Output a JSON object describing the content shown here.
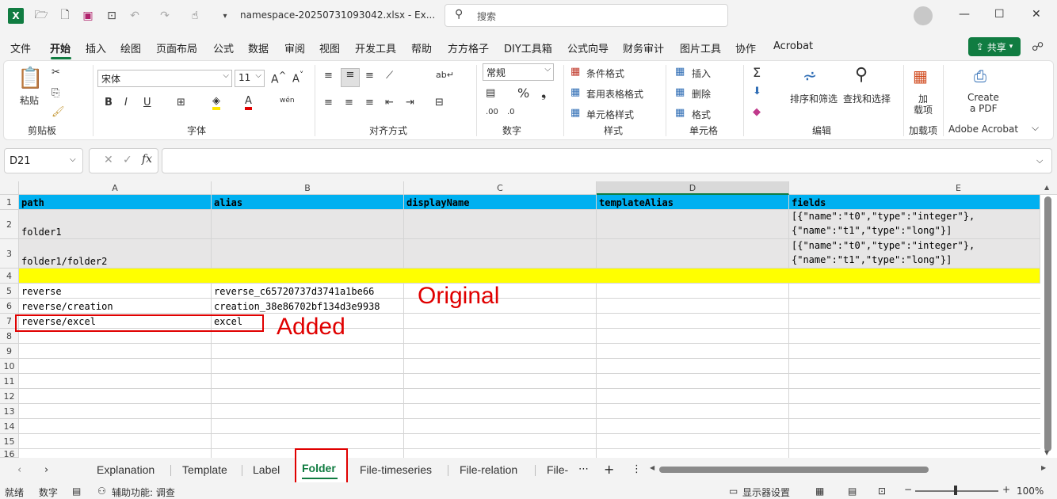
{
  "title_bar": {
    "filename": "namespace-20250731093042.xlsx  -  Ex...",
    "search_placeholder": "搜索"
  },
  "menu": [
    "文件",
    "开始",
    "插入",
    "绘图",
    "页面布局",
    "公式",
    "数据",
    "审阅",
    "视图",
    "开发工具",
    "帮助",
    "方方格子",
    "DIY工具箱",
    "公式向导",
    "财务审计",
    "图片工具",
    "协作",
    "Acrobat"
  ],
  "share_label": "共享",
  "ribbon": {
    "paste": "粘贴",
    "clipboard": "剪贴板",
    "font_name": "宋体",
    "font_size": "11",
    "font_group": "字体",
    "align_group": "对齐方式",
    "number_format": "常规",
    "number_group": "数字",
    "cond_format": "条件格式",
    "table_format": "套用表格格式",
    "cell_style": "单元格样式",
    "style_group": "样式",
    "insert": "插入",
    "delete": "删除",
    "format": "格式",
    "cells_group": "单元格",
    "sort_filter": "排序和筛选",
    "find_select": "查找和选择",
    "edit_group": "编辑",
    "addin_line1": "加",
    "addin_line2": "载项",
    "addin_group": "加载项",
    "pdf_line1": "Create",
    "pdf_line2": "a PDF",
    "acrobat_group": "Adobe Acrobat"
  },
  "name_box": "D21",
  "fx": "fx",
  "columns": [
    "A",
    "B",
    "C",
    "D",
    "E"
  ],
  "rows": [
    "1",
    "2",
    "3",
    "4",
    "5",
    "6",
    "7",
    "8",
    "9",
    "10",
    "11",
    "12",
    "13",
    "14",
    "15",
    "16"
  ],
  "cells": {
    "A1": "path",
    "B1": "alias",
    "C1": "displayName",
    "D1": "templateAlias",
    "E1": "fields",
    "A2": "folder1",
    "E2": "[{\"name\":\"t0\",\"type\":\"integer\"},\n{\"name\":\"t1\",\"type\":\"long\"}]",
    "A3": "folder1/folder2",
    "E3": "[{\"name\":\"t0\",\"type\":\"integer\"},\n{\"name\":\"t1\",\"type\":\"long\"}]",
    "A5": "reverse",
    "B5": "reverse_c65720737d3741a1be66",
    "A6": "reverse/creation",
    "B6": "creation_38e86702bf134d3e9938",
    "A7": "reverse/excel",
    "B7": "excel"
  },
  "annotations": {
    "original": "Original",
    "added": "Added"
  },
  "tabs": [
    "Explanation",
    "Template",
    "Label",
    "Folder",
    "File-timeseries",
    "File-relation",
    "File-…"
  ],
  "active_tab": "Folder",
  "status": {
    "ready": "就绪",
    "numlock": "数字",
    "accessibility": "辅助功能: 调查",
    "display_settings": "显示器设置",
    "zoom": "100%"
  },
  "colors": {
    "header_blue": "#00b0f0",
    "row_gray": "#e7e6e6",
    "highlight_yellow": "#ffff00",
    "annotation_red": "#e00000",
    "excel_green": "#107c41"
  }
}
